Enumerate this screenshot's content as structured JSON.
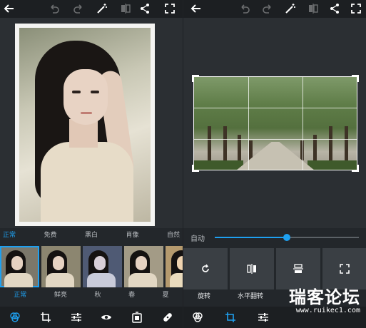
{
  "colors": {
    "accent": "#1ea0f0",
    "toolbar": "#1c1f22",
    "panel": "#23272b",
    "tool_bg": "#3a3f44"
  },
  "left": {
    "topbar": {
      "icons": [
        "back-arrow-icon",
        "undo-icon",
        "redo-icon",
        "magic-wand-icon",
        "compare-icon",
        "share-icon",
        "fullscreen-icon"
      ]
    },
    "filter_categories": [
      {
        "label": "正常",
        "active": true
      },
      {
        "label": "免费",
        "active": false
      },
      {
        "label": "黑白",
        "active": false
      },
      {
        "label": "肖像",
        "active": false
      },
      {
        "label": "自然",
        "active": false
      }
    ],
    "filter_presets": [
      {
        "label": "正常",
        "active": true
      },
      {
        "label": "鲜亮",
        "active": false
      },
      {
        "label": "秋",
        "active": false
      },
      {
        "label": "春",
        "active": false
      },
      {
        "label": "夏",
        "active": false
      }
    ],
    "bottom_tools": [
      "filters-icon",
      "crop-icon",
      "adjust-icon",
      "eye-icon",
      "frame-icon",
      "bandage-icon"
    ]
  },
  "right": {
    "topbar": {
      "icons": [
        "back-arrow-icon",
        "undo-icon",
        "redo-icon",
        "magic-wand-icon",
        "compare-icon",
        "share-icon",
        "fullscreen-icon"
      ]
    },
    "straighten": {
      "label": "自动",
      "value": 0.5
    },
    "tools": [
      {
        "label": "旋转",
        "icon": "rotate-icon"
      },
      {
        "label": "水平翻转",
        "icon": "flip-horizontal-icon"
      },
      {
        "label": "",
        "icon": "flip-vertical-icon"
      },
      {
        "label": "",
        "icon": "aspect-ratio-icon"
      }
    ],
    "bottom_tools": [
      "filters-icon",
      "crop-icon",
      "adjust-icon"
    ]
  },
  "watermark": {
    "title": "瑞客论坛",
    "url": "www.ruikec1.com"
  }
}
